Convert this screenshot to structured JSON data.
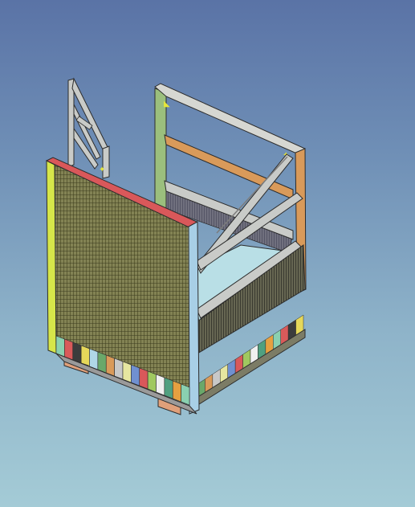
{
  "viewport": {
    "background_top": "#5a73a6",
    "background_bottom": "#a4cbd6"
  },
  "model": {
    "name": "",
    "colors": {
      "outline": "#2c2c2c",
      "frame_gray": "#c9cbc8",
      "frame_green": "#9bbf7d",
      "frame_orange": "#d99a5a",
      "frame_red": "#d9585a",
      "frame_yellow": "#d6e64a",
      "frame_blue": "#a8cfe6",
      "mesh_fill": "#6a6a3a",
      "floor": "#b9dfe6",
      "foot_pad": "#e0a07a"
    },
    "toe_board_strip_colors": [
      "#8ad0b0",
      "#d95a5a",
      "#3c3c3c",
      "#e6d85a",
      "#b0d8e6",
      "#6aa86a",
      "#d99a5a",
      "#c8c8c8",
      "#e6e6a0",
      "#7090d0",
      "#d9585a",
      "#a0c860",
      "#f0f0f0",
      "#50a080",
      "#e6a040"
    ]
  },
  "icons": {
    "corner_marker": "corner-marker-icon"
  }
}
